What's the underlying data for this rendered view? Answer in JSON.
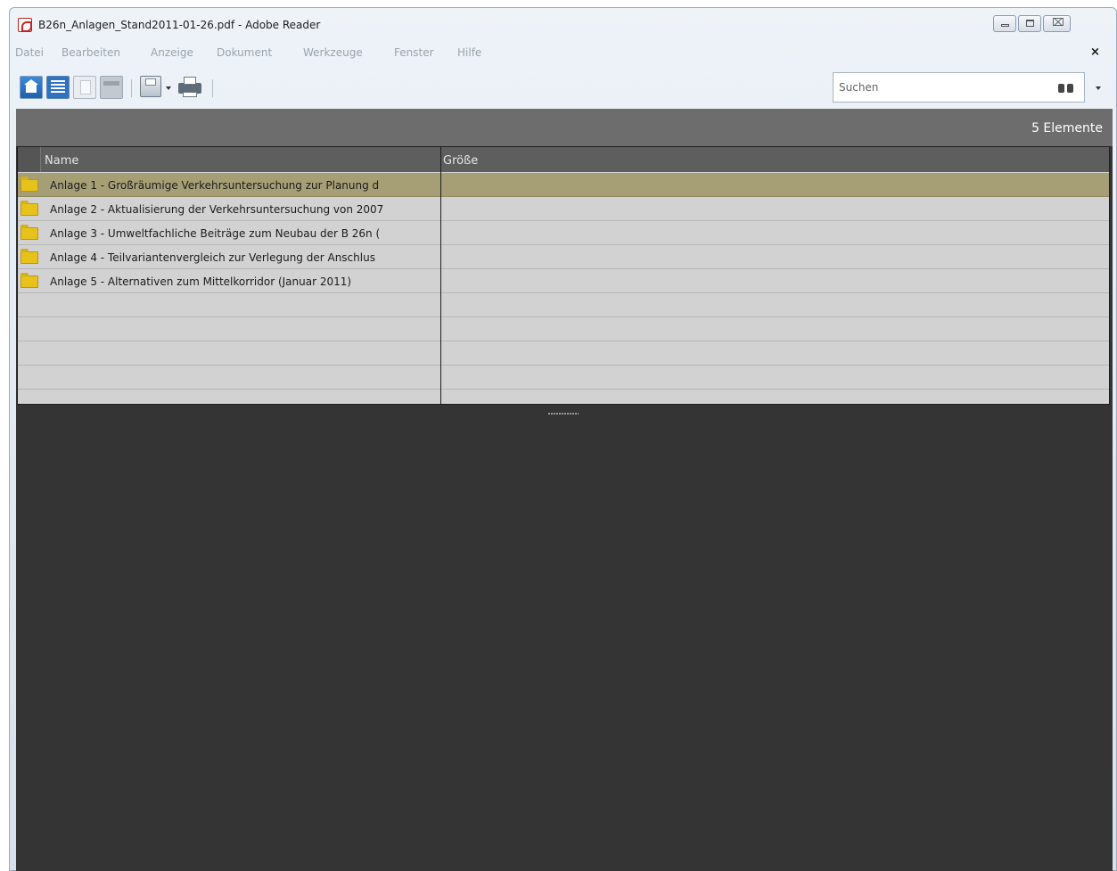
{
  "window": {
    "title": "B26n_Anlagen_Stand2011-01-26.pdf - Adobe Reader",
    "controls": {
      "minimize": "minimize",
      "maximize": "maximize",
      "close": "⌧"
    }
  },
  "menu": [
    "Datei",
    "Bearbeiten",
    "Anzeige",
    "Dokument",
    "Werkzeuge",
    "Fenster",
    "Hilfe"
  ],
  "doc_close": "×",
  "toolbar": {
    "buttons": [
      "home-icon",
      "list-view-icon",
      "page-view-icon",
      "strip-view-icon",
      "save-icon",
      "print-icon"
    ],
    "search": {
      "placeholder": "Suchen",
      "value": ""
    }
  },
  "portfolio": {
    "item_count": "5 Elemente",
    "columns": [
      "Name",
      "Größe"
    ],
    "rows": [
      {
        "name": "Anlage 1 - Großräumige Verkehrsuntersuchung zur Planung d",
        "size": "",
        "selected": true
      },
      {
        "name": "Anlage 2 - Aktualisierung der Verkehrsuntersuchung von 2007",
        "size": "",
        "selected": false
      },
      {
        "name": "Anlage 3 - Umweltfachliche Beiträge zum Neubau der B 26n (",
        "size": "",
        "selected": false
      },
      {
        "name": "Anlage 4 - Teilvariantenvergleich zur Verlegung der Anschlus",
        "size": "",
        "selected": false
      },
      {
        "name": "Anlage 5 - Alternativen zum Mittelkorridor (Januar 2011)",
        "size": "",
        "selected": false
      }
    ]
  },
  "colors": {
    "selected_row": "#a69f76",
    "row_background": "#d2d2d2",
    "count_bar": "#6d6d6d",
    "preview_background": "#343434",
    "folder": "#e7c21b"
  }
}
